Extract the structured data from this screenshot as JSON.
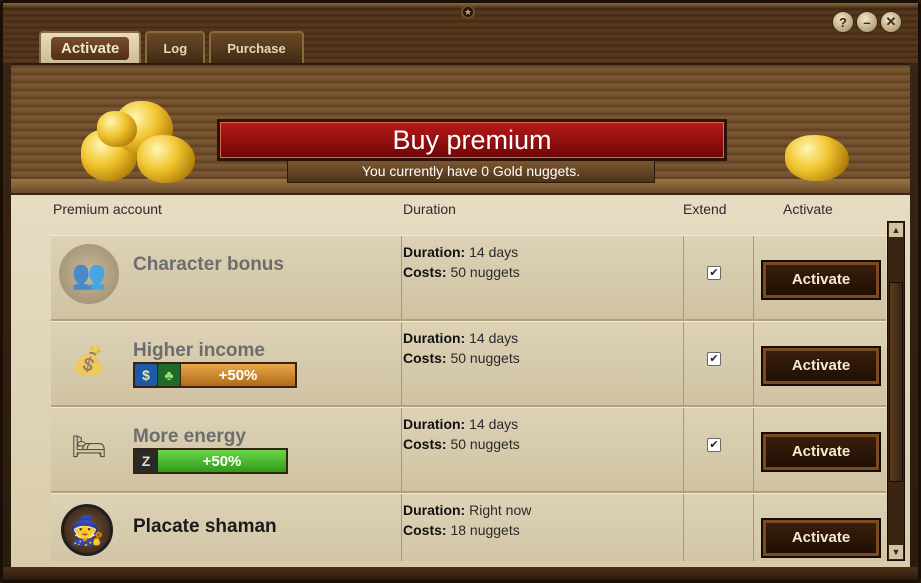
{
  "window": {
    "controls": {
      "help": "?",
      "minimize": "–",
      "close": "✕"
    }
  },
  "tabs": [
    {
      "label": "Activate"
    },
    {
      "label": "Log"
    },
    {
      "label": "Purchase"
    }
  ],
  "banner": {
    "title": "Buy premium",
    "subtitle": "You currently have 0 Gold nuggets."
  },
  "columns": {
    "account": "Premium account",
    "duration": "Duration",
    "extend": "Extend",
    "activate": "Activate"
  },
  "rows": [
    {
      "icon": "character-portrait-icon",
      "title": "Character bonus",
      "duration_label": "Duration:",
      "duration_value": "14 days",
      "costs_label": "Costs:",
      "costs_value": "50 nuggets",
      "extend_checked": true,
      "button": "Activate"
    },
    {
      "icon": "money-stack-icon",
      "title": "Higher income",
      "bonus": {
        "text": "+50%",
        "icons": [
          "dollar-icon",
          "clover-icon"
        ],
        "color": "#d08a2a"
      },
      "duration_label": "Duration:",
      "duration_value": "14 days",
      "costs_label": "Costs:",
      "costs_value": "50 nuggets",
      "extend_checked": true,
      "button": "Activate"
    },
    {
      "icon": "bed-icon",
      "title": "More energy",
      "bonus": {
        "text": "+50%",
        "icons": [
          "sleep-z-icon"
        ],
        "color": "#4cb82a"
      },
      "duration_label": "Duration:",
      "duration_value": "14 days",
      "costs_label": "Costs:",
      "costs_value": "50 nuggets",
      "extend_checked": true,
      "button": "Activate"
    },
    {
      "icon": "shaman-portrait-icon",
      "title": "Placate shaman",
      "duration_label": "Duration:",
      "duration_value": "Right now",
      "costs_label": "Costs:",
      "costs_value": "18 nuggets",
      "extend_checked": false,
      "button": "Activate"
    }
  ],
  "colors": {
    "banner_red": "#a01010",
    "wood_dark": "#3b2614",
    "paper": "#ddd2b6",
    "gold": "#f2c530"
  }
}
